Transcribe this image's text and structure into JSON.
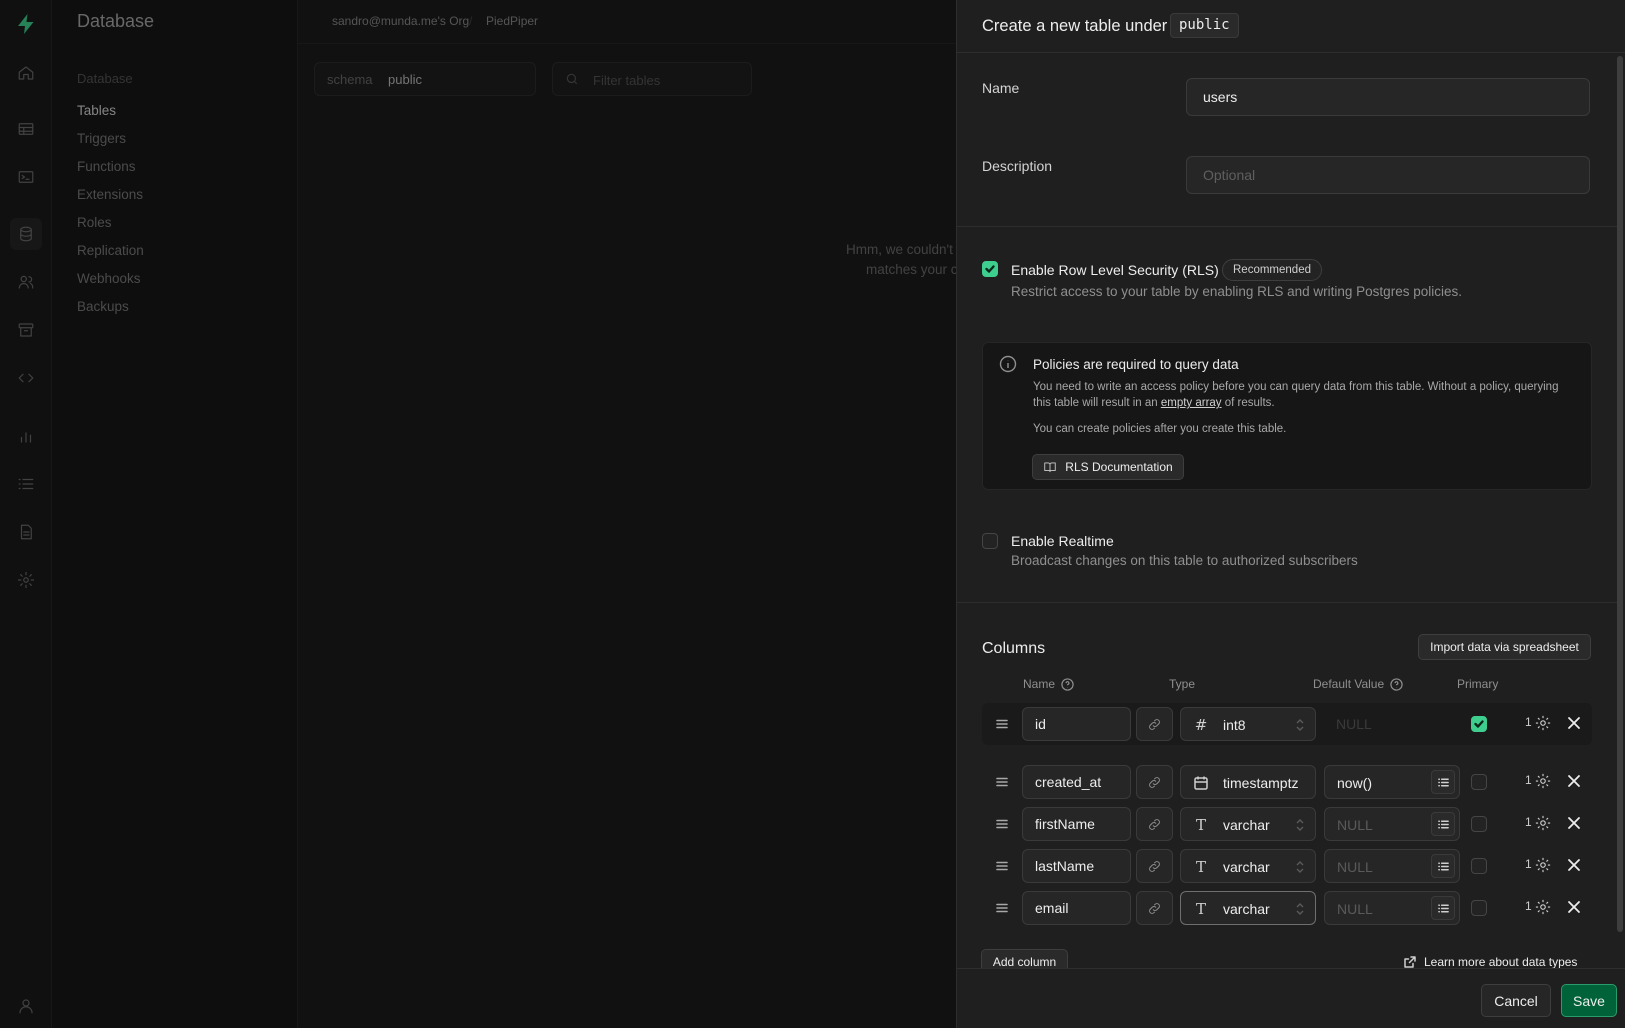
{
  "app": {
    "title": "Database",
    "org": "sandro@munda.me's Org",
    "project": "PiedPiper"
  },
  "sidebar": {
    "section": "Database",
    "items": [
      {
        "label": "Tables"
      },
      {
        "label": "Triggers"
      },
      {
        "label": "Functions"
      },
      {
        "label": "Extensions"
      },
      {
        "label": "Roles"
      },
      {
        "label": "Replication"
      },
      {
        "label": "Webhooks"
      },
      {
        "label": "Backups"
      }
    ]
  },
  "toolbar": {
    "schema_label": "schema",
    "schema_value": "public",
    "filter_placeholder": "Filter tables"
  },
  "empty": {
    "line1": "Hmm, we couldn't",
    "line2": "matches your c"
  },
  "panel": {
    "title": "Create a new table under",
    "schema": "public",
    "name_label": "Name",
    "name_value": "users",
    "description_label": "Description",
    "description_placeholder": "Optional",
    "rls": {
      "label": "Enable Row Level Security (RLS)",
      "badge": "Recommended",
      "subtitle": "Restrict access to your table by enabling RLS and writing Postgres policies.",
      "checked": true
    },
    "notice": {
      "title": "Policies are required to query data",
      "body_a": "You need to write an access policy before you can query data from this table. Without a policy, querying this table will result in an ",
      "body_link": "empty array",
      "body_b": " of results.",
      "body2": "You can create policies after you create this table.",
      "button": "RLS Documentation"
    },
    "realtime": {
      "label": "Enable Realtime",
      "subtitle": "Broadcast changes on this table to authorized subscribers",
      "checked": false
    },
    "columns": {
      "title": "Columns",
      "import_button": "Import data via spreadsheet",
      "headers": {
        "name": "Name",
        "type": "Type",
        "default": "Default Value",
        "primary": "Primary"
      },
      "rows": [
        {
          "name": "id",
          "type": "int8",
          "type_icon": "hash-icon",
          "default": "NULL",
          "default_placeholder": true,
          "primary": true,
          "count": "1"
        },
        {
          "name": "created_at",
          "type": "timestamptz",
          "type_icon": "calendar-icon",
          "default": "now()",
          "default_placeholder": false,
          "primary": false,
          "count": "1"
        },
        {
          "name": "firstName",
          "type": "varchar",
          "type_icon": "text-icon",
          "default": "NULL",
          "default_placeholder": true,
          "primary": false,
          "count": "1"
        },
        {
          "name": "lastName",
          "type": "varchar",
          "type_icon": "text-icon",
          "default": "NULL",
          "default_placeholder": true,
          "primary": false,
          "count": "1"
        },
        {
          "name": "email",
          "type": "varchar",
          "type_icon": "text-icon",
          "default": "NULL",
          "default_placeholder": true,
          "primary": false,
          "count": "1"
        }
      ],
      "add_button": "Add column",
      "learn_link": "Learn more about data types"
    },
    "footer": {
      "cancel": "Cancel",
      "save": "Save"
    }
  },
  "colors": {
    "accent": "#3ecf8e",
    "save_bg": "#006239"
  }
}
